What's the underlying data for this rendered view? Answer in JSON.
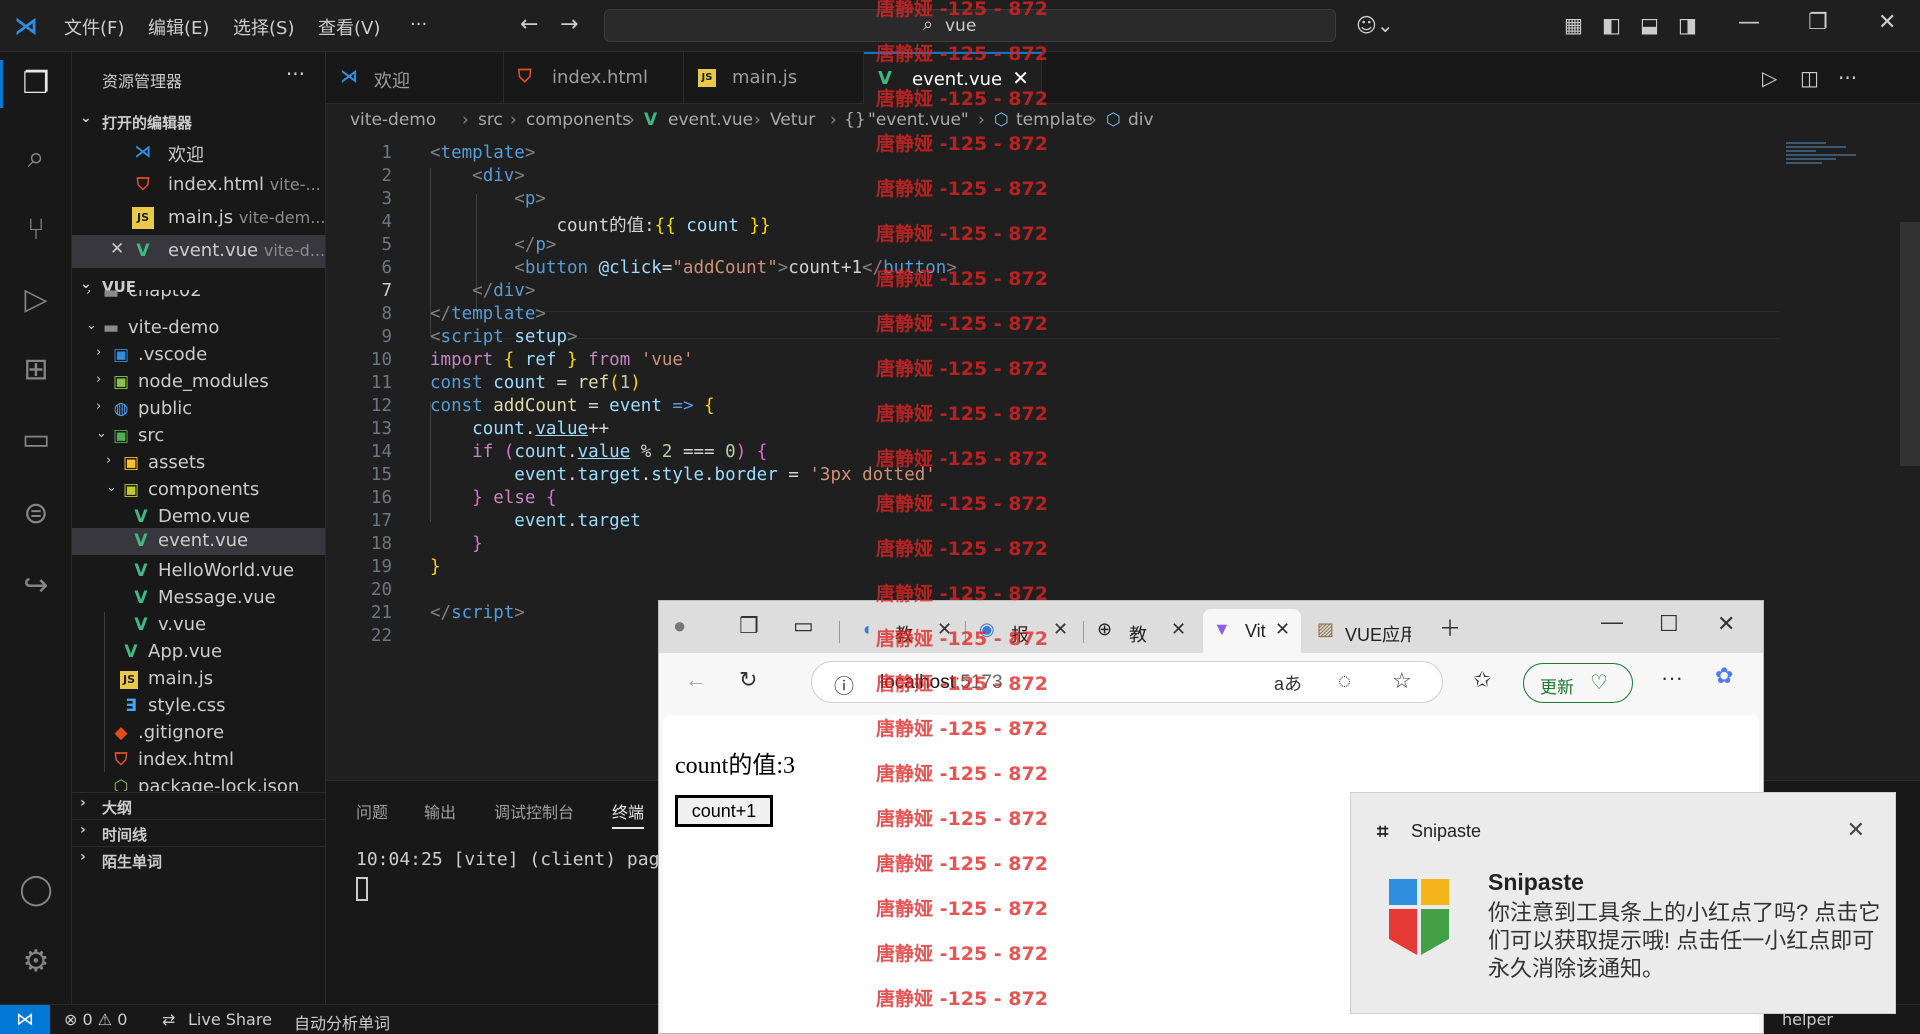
{
  "menu": [
    "文件(F)",
    "编辑(E)",
    "选择(S)",
    "查看(V)",
    "···"
  ],
  "command_center": "vue",
  "sidebar": {
    "title": "资源管理器",
    "more": "···",
    "open_editors_header": "打开的编辑器",
    "open_editors": [
      {
        "name": "欢迎",
        "sub": ""
      },
      {
        "name": "index.html",
        "sub": "vite-..."
      },
      {
        "name": "main.js",
        "sub": "vite-dem..."
      },
      {
        "name": "event.vue",
        "sub": "vite-d..."
      }
    ],
    "workspace_header": "VUE",
    "tree": [
      "chapt02",
      "vite-demo",
      ".vscode",
      "node_modules",
      "public",
      "src",
      "assets",
      "components",
      "Demo.vue",
      "event.vue",
      "HelloWorld.vue",
      "Message.vue",
      "v.vue",
      "App.vue",
      "main.js",
      "style.css",
      ".gitignore",
      "index.html",
      "package-lock.json"
    ],
    "outline_header": "大纲",
    "timeline_header": "时间线",
    "words_header": "陌生单词"
  },
  "tabs": [
    {
      "name": "欢迎"
    },
    {
      "name": "index.html"
    },
    {
      "name": "main.js"
    },
    {
      "name": "event.vue"
    }
  ],
  "breadcrumb": [
    "vite-demo",
    "src",
    "components",
    "event.vue",
    "Vetur",
    "\"event.vue\"",
    "template",
    "div"
  ],
  "editor": {
    "current_line": 7,
    "line_numbers": [
      "1",
      "2",
      "3",
      "4",
      "5",
      "6",
      "7",
      "8",
      "9",
      "10",
      "11",
      "12",
      "13",
      "14",
      "15",
      "16",
      "17",
      "18",
      "19",
      "20",
      "21",
      "22"
    ]
  },
  "panel": {
    "tabs": [
      "问题",
      "输出",
      "调试控制台",
      "终端"
    ],
    "terminal_line": "10:04:25 [vite] (client) pag"
  },
  "statusbar": {
    "errors": "⊗ 0 ⚠ 0",
    "live_share": "Live Share",
    "auto_words": "自动分析单词",
    "helper": "helper"
  },
  "browser": {
    "tabs": [
      {
        "name": "教"
      },
      {
        "name": "报"
      },
      {
        "name": "教"
      },
      {
        "name": "Vit"
      },
      {
        "name": "VUE应用"
      }
    ],
    "address_host": "localhost",
    "address_port": ":5173",
    "update_label": "更新",
    "page_text": "count的值:3",
    "page_button": "count+1"
  },
  "toast": {
    "app": "Snipaste",
    "title": "Snipaste",
    "message": "你注意到工具条上的小红点了吗? 点击它们可以获取提示哦! 点击任一小红点即可永久消除该通知。"
  },
  "watermark": "唐静娅 -125 - 872",
  "colors": {
    "accent": "#0078d4",
    "watermark": "#e02424",
    "vue_green": "#41b883"
  }
}
